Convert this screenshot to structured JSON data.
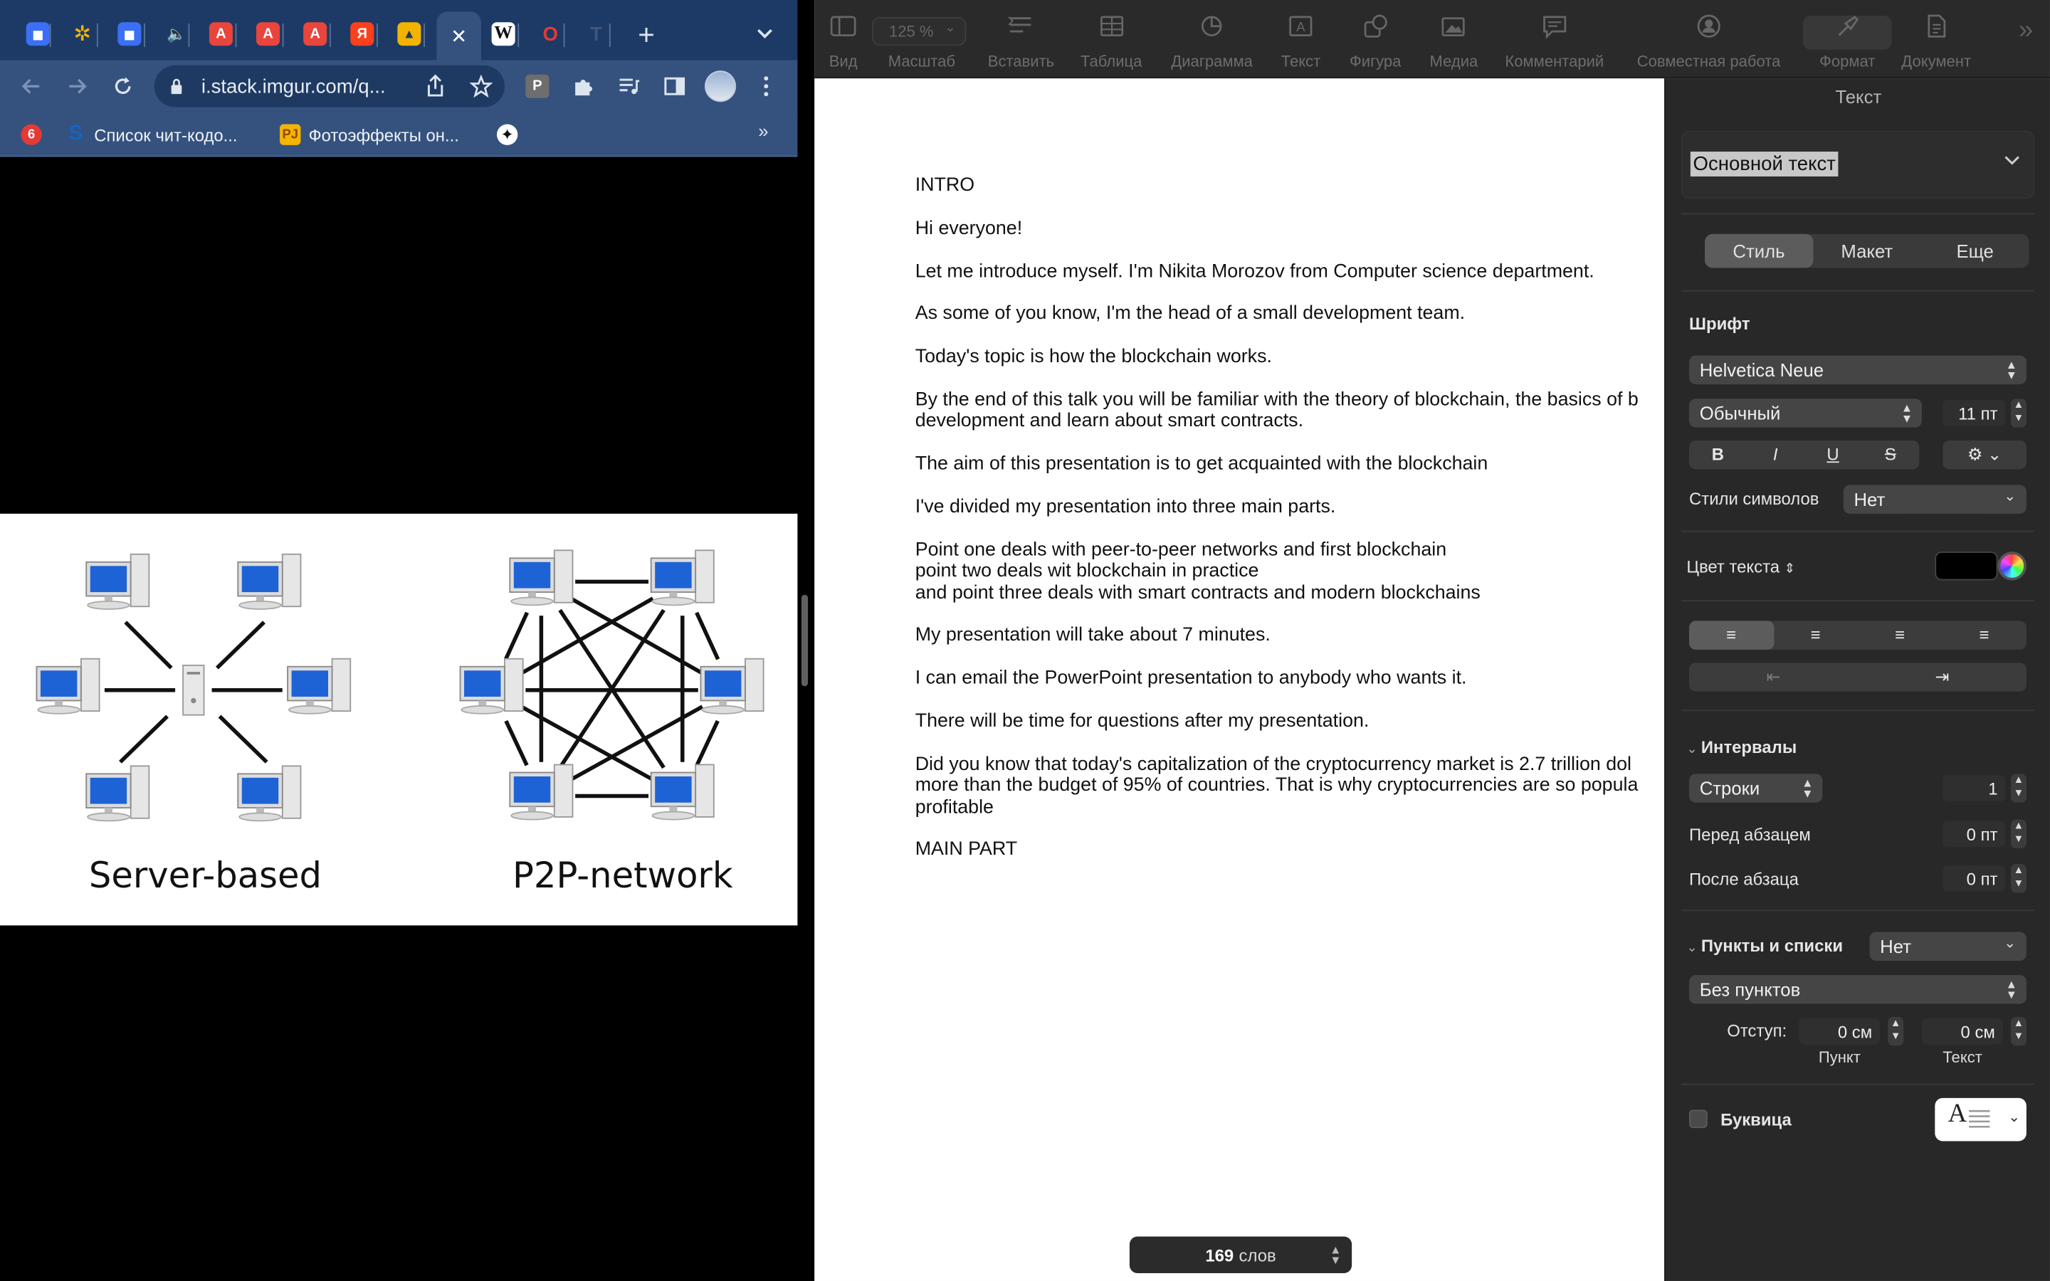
{
  "browser": {
    "tabs": [
      {
        "icon": "chat-icon",
        "color": "#3b6ff5",
        "glyph": "◼"
      },
      {
        "icon": "pinwheel-icon",
        "color": "#1d3a66",
        "glyph": "✲"
      },
      {
        "icon": "chat-icon-2",
        "color": "#3b6ff5",
        "glyph": "◼"
      },
      {
        "icon": "speaker-icon",
        "color": "#1d3a66",
        "glyph": "🔈"
      },
      {
        "icon": "translate-icon",
        "color": "#e8453c",
        "glyph": "A"
      },
      {
        "icon": "translate-icon-2",
        "color": "#e8453c",
        "glyph": "A"
      },
      {
        "icon": "translate-icon-3",
        "color": "#e8453c",
        "glyph": "A"
      },
      {
        "icon": "yandex-icon",
        "color": "#fc3f1d",
        "glyph": "Я"
      },
      {
        "icon": "image-icon",
        "color": "#f2b400",
        "glyph": "▲"
      },
      {
        "icon": "close-icon",
        "color": "#35527e",
        "glyph": "✕"
      },
      {
        "icon": "wikipedia-icon",
        "color": "#ffffff",
        "glyph": "W"
      },
      {
        "icon": "opera-icon",
        "color": "#1d3a66",
        "glyph": "O"
      },
      {
        "icon": "t-icon",
        "color": "#1d3a66",
        "glyph": "T"
      }
    ],
    "new_tab": "+",
    "url": "i.stack.imgur.com/q...",
    "bookmarks": [
      {
        "label": "",
        "icon": "six-icon",
        "glyph": "6",
        "color": "#e53935"
      },
      {
        "label": "Список чит-кодо...",
        "icon": "s-icon",
        "glyph": "S",
        "color": "#1565c0"
      },
      {
        "label": "Фотоэффекты он...",
        "icon": "photo-effects-icon",
        "glyph": "PJ",
        "color": "#f5b400"
      },
      {
        "label": "",
        "icon": "sparkle-icon",
        "glyph": "✦",
        "color": "#111111"
      }
    ],
    "bookmarks_more": "»",
    "image": {
      "left_caption": "Server-based",
      "right_caption": "P2P-network"
    }
  },
  "pages": {
    "toolbar": [
      {
        "label": "Вид",
        "icon": "sidebar-icon"
      },
      {
        "label": "Масштаб",
        "icon": "zoom-icon"
      },
      {
        "label": "Вставить",
        "icon": "insert-icon"
      },
      {
        "label": "Таблица",
        "icon": "table-icon"
      },
      {
        "label": "Диаграмма",
        "icon": "chart-icon"
      },
      {
        "label": "Текст",
        "icon": "textbox-icon"
      },
      {
        "label": "Фигура",
        "icon": "shape-icon"
      },
      {
        "label": "Медиа",
        "icon": "media-icon"
      },
      {
        "label": "Комментарий",
        "icon": "comment-icon"
      },
      {
        "label": "Совместная работа",
        "icon": "collaborate-icon"
      },
      {
        "label": "Формат",
        "icon": "format-brush-icon"
      },
      {
        "label": "Документ",
        "icon": "document-icon"
      }
    ],
    "zoom_value": "125 %",
    "more": "»",
    "document": {
      "paragraphs": [
        [
          "INTRO"
        ],
        [
          "Hi everyone!"
        ],
        [
          "Let me introduce myself. I'm Nikita Morozov from Computer science department."
        ],
        [
          "As some of you know, I'm the head of a small development team."
        ],
        [
          "Today's topic is how the blockchain works."
        ],
        [
          "By the end of this talk you will be familiar with the theory of blockchain, the basics of b",
          "development and learn about smart contracts."
        ],
        [
          "The aim of this presentation is to get acquainted with the blockchain"
        ],
        [
          "I've divided my presentation into three main parts."
        ],
        [
          "Point one deals with peer-to-peer networks and first blockchain",
          "point two deals wit blockchain in practice",
          "and point three deals with smart contracts and modern blockchains"
        ],
        [
          "My presentation will take about 7 minutes."
        ],
        [
          "I can email the PowerPoint presentation to anybody who wants it."
        ],
        [
          "There will be time for questions after my presentation."
        ],
        [
          "Did you know that today's capitalization of the cryptocurrency market is 2.7 trillion dol",
          "more than the budget of 95% of countries. That is why cryptocurrencies are so popula",
          "profitable"
        ],
        [
          "MAIN PART"
        ]
      ]
    },
    "word_count": {
      "number": "169",
      "label": "слов"
    },
    "inspector": {
      "title": "Текст",
      "paragraph_style": "Основной текст",
      "tabs": [
        "Стиль",
        "Макет",
        "Еще"
      ],
      "font_header": "Шрифт",
      "font_family": "Helvetica Neue",
      "font_typeface": "Обычный",
      "font_size": "11 пт",
      "bold": "B",
      "italic": "I",
      "underline": "U",
      "strike": "S",
      "char_styles_label": "Стили символов",
      "char_styles_value": "Нет",
      "text_color_label": "Цвет текста",
      "text_color": "#000000",
      "spacing_header": "Интервалы",
      "spacing_mode": "Строки",
      "spacing_value": "1",
      "before_para_label": "Перед абзацем",
      "before_para_value": "0 пт",
      "after_para_label": "После абзаца",
      "after_para_value": "0 пт",
      "bullets_header": "Пункты и списки",
      "bullets_value": "Нет",
      "bullets_style": "Без пунктов",
      "indent_label": "Отступ:",
      "indent_bullet_value": "0 см",
      "indent_text_value": "0 см",
      "indent_bullet_caption": "Пункт",
      "indent_text_caption": "Текст",
      "dropcap_label": "Буквица",
      "dropcap_glyph": "A"
    }
  }
}
